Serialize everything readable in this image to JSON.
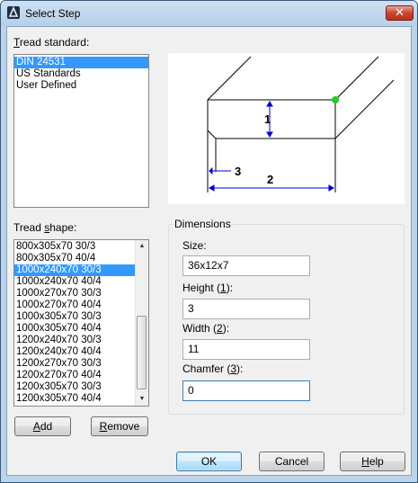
{
  "window": {
    "title": "Select Step"
  },
  "tread_standard": {
    "label_u": "T",
    "label_rest": "read standard:",
    "items": [
      "DIN 24531",
      "US Standards",
      "User Defined"
    ],
    "selected_index": 0
  },
  "tread_shape": {
    "label_pre": "Tread ",
    "label_u": "s",
    "label_rest": "hape:",
    "items": [
      "800x305x70 30/3",
      "800x305x70 40/4",
      "1000x240x70 30/3",
      "1000x240x70 40/4",
      "1000x270x70 30/3",
      "1000x270x70 40/4",
      "1000x305x70 30/3",
      "1000x305x70 40/4",
      "1200x240x70 30/3",
      "1200x240x70 40/4",
      "1200x270x70 30/3",
      "1200x270x70 40/4",
      "1200x305x70 30/3",
      "1200x305x70 40/4"
    ],
    "selected_index": 2,
    "scroll_fraction": 0.62
  },
  "preview": {
    "dim1": "1",
    "dim2": "2",
    "dim3": "3"
  },
  "dimensions": {
    "title": "Dimensions",
    "size_label": "Size:",
    "size_value": "36x12x7",
    "height_pre": "Height (",
    "height_u": "1",
    "height_post": "):",
    "height_value": "3",
    "width_pre": "Width (",
    "width_u": "2",
    "width_post": "):",
    "width_value": "11",
    "chamfer_pre": "Chamfer (",
    "chamfer_u": "3",
    "chamfer_post": "):",
    "chamfer_value": "0"
  },
  "buttons": {
    "add_u": "A",
    "add_rest": "dd",
    "remove_u": "R",
    "remove_rest": "emove",
    "ok": "OK",
    "cancel": "Cancel",
    "help_u": "H",
    "help_rest": "elp",
    "close": "✕"
  },
  "colors": {
    "accent": "#3399ff",
    "dimension_lines": "#0000cc",
    "vertex_marker": "#22cc22"
  }
}
